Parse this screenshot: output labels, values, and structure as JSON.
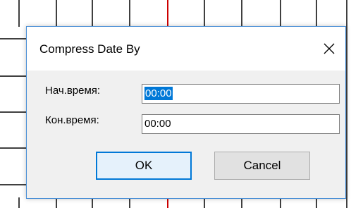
{
  "dialog": {
    "title": "Compress Date By",
    "close_glyph": "close-icon"
  },
  "fields": {
    "start_label": "Нач.время:",
    "start_value": "00:00",
    "end_label": "Кон.время:",
    "end_value": "00:00"
  },
  "buttons": {
    "ok": "OK",
    "cancel": "Cancel"
  },
  "colors": {
    "accent": "#0078d7",
    "dialog_border": "#4a8fd6",
    "grid_marker": "#cc0000"
  }
}
